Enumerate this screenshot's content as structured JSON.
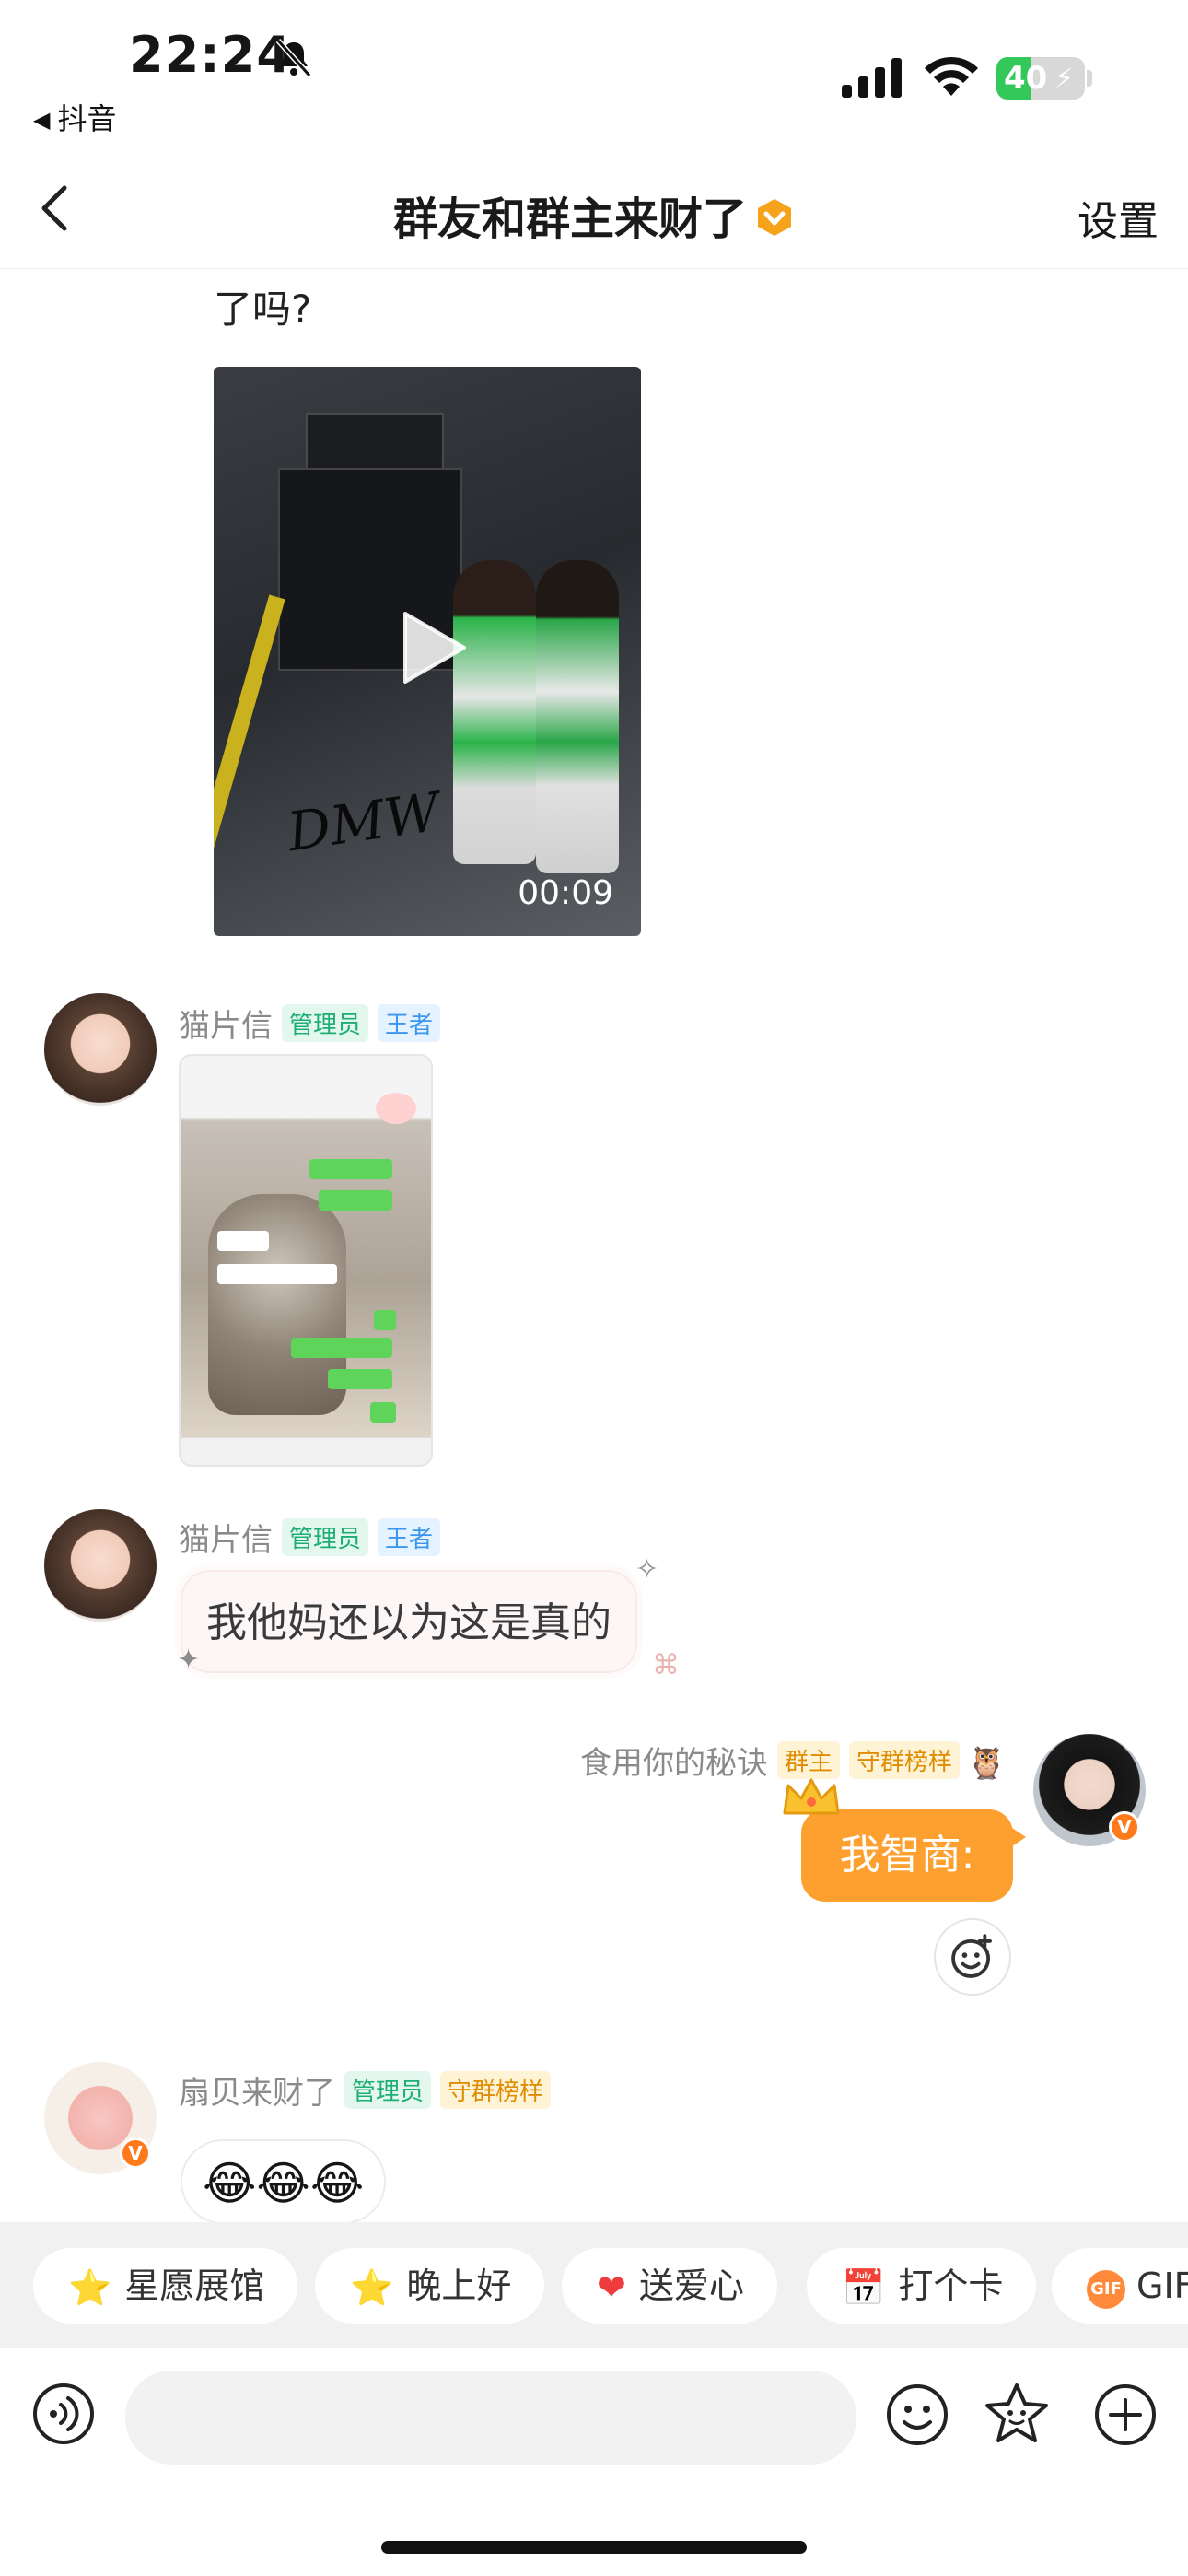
{
  "status_bar": {
    "time": "22:24",
    "back_app": "抖音",
    "battery": "40",
    "battery_level_percent": 40,
    "icons": [
      "bell-mute-icon",
      "cellular-signal-icon",
      "wifi-icon",
      "battery-charging-icon"
    ]
  },
  "header": {
    "title": "群友和群主来财了",
    "settings_label": "设置",
    "badge_color": "#f7a21b"
  },
  "messages": {
    "m1": {
      "text": "了吗?"
    },
    "m2": {
      "type": "video",
      "duration": "00:09",
      "watermark": "DMW"
    },
    "m3": {
      "sender": "猫片信",
      "tags": [
        "管理员",
        "王者"
      ],
      "type": "image"
    },
    "m4": {
      "sender": "猫片信",
      "tags": [
        "管理员",
        "王者"
      ],
      "text": "我他妈还以为这是真的"
    },
    "m5": {
      "sender": "食用你的秘诀",
      "tags": [
        "群主",
        "守群榜样"
      ],
      "text": "我智商:"
    },
    "m6": {
      "sender": "扇贝来财了",
      "tags": [
        "管理员",
        "守群榜样"
      ],
      "text": "😂😂😂"
    }
  },
  "quick_replies": [
    {
      "icon": "star-face-icon",
      "glyph": "⭐",
      "label": "星愿展馆"
    },
    {
      "icon": "star-face-icon",
      "glyph": "⭐",
      "label": "晚上好"
    },
    {
      "icon": "heart-icon",
      "glyph": "❤",
      "label": "送爱心"
    },
    {
      "icon": "calendar-icon",
      "glyph": "📅",
      "label": "打个卡"
    },
    {
      "icon": "gif-icon",
      "glyph": "GIF",
      "label": "GIF"
    }
  ],
  "input": {
    "placeholder": ""
  },
  "colors": {
    "accent": "#fea02f",
    "admin_tag": "#1cae73",
    "king_tag": "#3a97ef",
    "owner_tag": "#e08c00"
  }
}
